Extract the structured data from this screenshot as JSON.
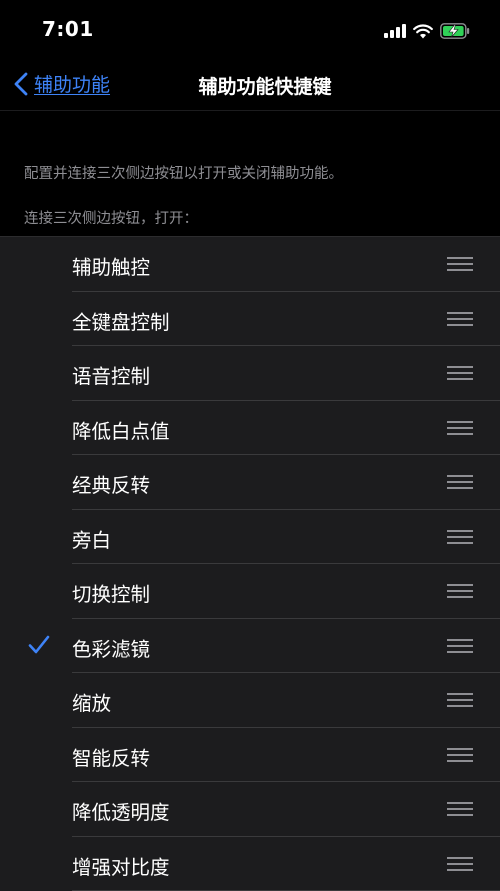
{
  "status": {
    "time": "7:01"
  },
  "nav": {
    "back_label": "辅助功能",
    "title": "辅助功能快捷键"
  },
  "description": "配置并连接三次侧边按钮以打开或关闭辅助功能。",
  "section_header": "连接三次侧边按钮，打开：",
  "colors": {
    "accent": "#3e83f7",
    "battery": "#30d158",
    "background": "#000000",
    "cell": "#1c1c1e"
  },
  "items": [
    {
      "label": "辅助触控",
      "checked": false
    },
    {
      "label": "全键盘控制",
      "checked": false
    },
    {
      "label": "语音控制",
      "checked": false
    },
    {
      "label": "降低白点值",
      "checked": false
    },
    {
      "label": "经典反转",
      "checked": false
    },
    {
      "label": "旁白",
      "checked": false
    },
    {
      "label": "切换控制",
      "checked": false
    },
    {
      "label": "色彩滤镜",
      "checked": true
    },
    {
      "label": "缩放",
      "checked": false
    },
    {
      "label": "智能反转",
      "checked": false
    },
    {
      "label": "降低透明度",
      "checked": false
    },
    {
      "label": "增强对比度",
      "checked": false
    }
  ]
}
